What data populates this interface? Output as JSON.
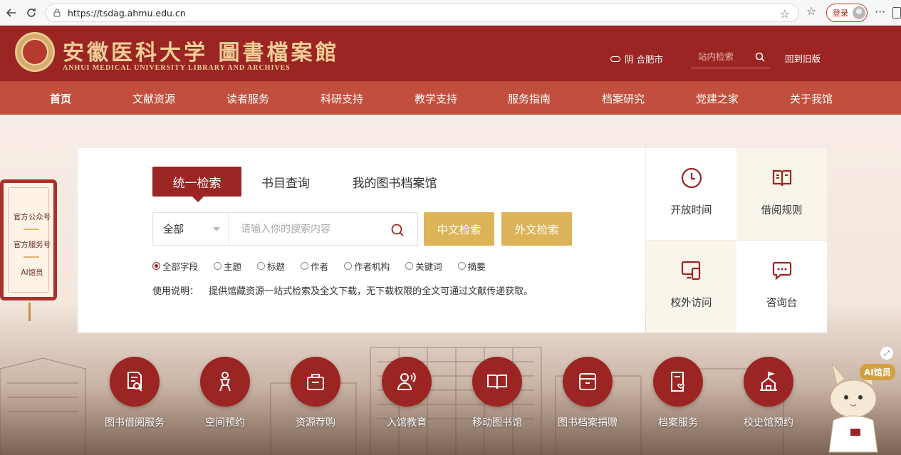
{
  "browser": {
    "url": "https://tsdag.ahmu.edu.cn",
    "login_label": "登录"
  },
  "header": {
    "logo_cn": "安徽医科大学 圖書檔案館",
    "logo_en": "ANHUI MEDICAL UNIVERSITY   LIBRARY AND ARCHIVES",
    "weather": "阴 合肥市",
    "site_search_placeholder": "站内检索",
    "old_version_label": "回到旧版"
  },
  "nav": {
    "items": [
      "首页",
      "文献资源",
      "读者服务",
      "科研支持",
      "教学支持",
      "服务指南",
      "档案研究",
      "党建之家",
      "关于我馆"
    ]
  },
  "side_tag": {
    "items": [
      "官方公众号",
      "官方服务号",
      "AI馆员"
    ]
  },
  "search": {
    "tabs": [
      "统一检索",
      "书目查询",
      "我的图书档案馆"
    ],
    "scope": "全部",
    "placeholder": "请输入你的搜索内容",
    "btn_cn": "中文检索",
    "btn_foreign": "外文检索",
    "fields": [
      "全部字段",
      "主题",
      "标题",
      "作者",
      "作者机构",
      "关键词",
      "摘要"
    ],
    "usage_label": "使用说明：",
    "usage_text": "提供馆藏资源一站式检索及全文下载，无下载权限的全文可通过文献传递获取。"
  },
  "quick": {
    "items": [
      {
        "label": "开放时间",
        "icon": "clock-icon"
      },
      {
        "label": "借阅规则",
        "icon": "open-book-icon"
      },
      {
        "label": "校外访问",
        "icon": "remote-access-icon"
      },
      {
        "label": "咨询台",
        "icon": "chat-icon"
      }
    ]
  },
  "services": {
    "items": [
      "图书借阅服务",
      "空间预约",
      "资源荐购",
      "入馆教育",
      "移动图书馆",
      "图书档案捐赠",
      "档案服务",
      "校史馆预约"
    ]
  },
  "ai": {
    "badge": "AI馆员"
  },
  "colors": {
    "brand_red": "#9b2523",
    "nav_red": "#c24f3d",
    "gold": "#dcb358"
  }
}
